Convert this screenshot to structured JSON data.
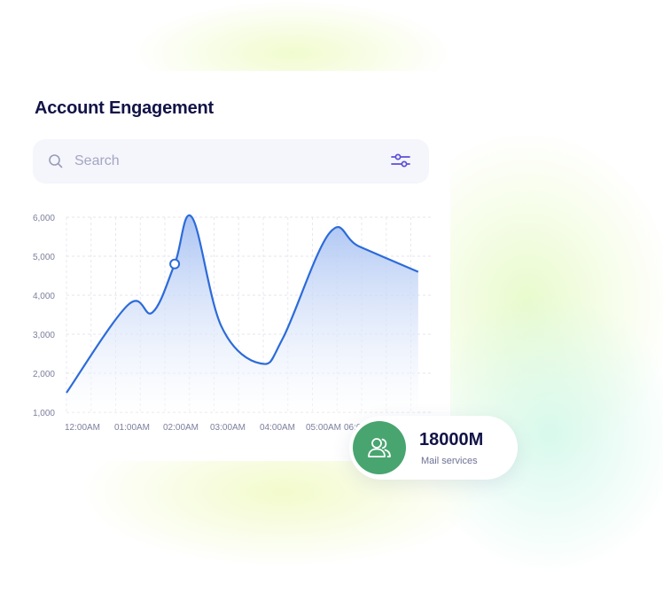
{
  "header": {
    "title": "Account Engagement"
  },
  "search": {
    "placeholder": "Search"
  },
  "icons": {
    "search": "search-icon",
    "filter": "sliders-icon",
    "users": "users-icon"
  },
  "colors": {
    "line": "#2c6bd9",
    "fill_top": "#a9c3f3",
    "accent_green": "#48a56f",
    "title": "#121347"
  },
  "chart_data": {
    "type": "area",
    "title": "",
    "xlabel": "",
    "ylabel": "",
    "y_ticks": [
      "6,000",
      "5,000",
      "4,000",
      "3,000",
      "2,000",
      "1,000"
    ],
    "y_tick_values": [
      6000,
      5000,
      4000,
      3000,
      2000,
      1000
    ],
    "x_ticks": [
      "12:00AM",
      "01:00AM",
      "02:00AM",
      "03:00AM",
      "04:00AM",
      "05:00AM",
      "06:00AM"
    ],
    "ylim": [
      1000,
      6000
    ],
    "grid": true,
    "series": [
      {
        "x": [
          0,
          1.25,
          1.75,
          2.2,
          2.55,
          3.15,
          3.95,
          4.4,
          5.35,
          5.95,
          7.15
        ],
        "values": [
          1500,
          3750,
          3560,
          4800,
          6000,
          3200,
          2250,
          2900,
          5600,
          5250,
          4600
        ]
      }
    ],
    "highlight_point": {
      "x": 2.2,
      "value": 4800
    }
  },
  "stat": {
    "value": "18000M",
    "label": "Mail services"
  }
}
